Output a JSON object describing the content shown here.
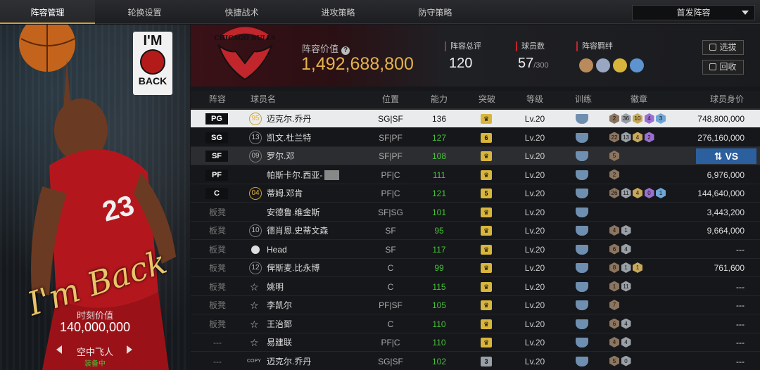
{
  "nav": {
    "tabs": [
      "阵容管理",
      "轮换设置",
      "快捷战术",
      "进攻策略",
      "防守策略"
    ],
    "active_tab": "阵容管理",
    "lineup_select": "首发阵容"
  },
  "left_panel": {
    "logo_text_top": "I'M",
    "logo_text_bottom": "BACK",
    "signature": "I'm Back",
    "value_label": "时刻价值",
    "value": "140,000,000",
    "skin_name": "空中飞人",
    "skin_status": "装备中"
  },
  "header": {
    "team_logo_text": "CHICAGO BULLS",
    "lineup_value_label": "阵容价值",
    "lineup_value": "1,492,688,800",
    "overall_label": "阵容总评",
    "overall": "120",
    "players_label": "球员数",
    "players": "57",
    "players_max": "/300",
    "bonds_label": "阵容羁绊",
    "filter_button": "选拔",
    "recycle_button": "回收"
  },
  "colors": {
    "accent": "#c9a23a",
    "value_gold": "#e5b24a",
    "power_green": "#46c23a",
    "vs_blue": "#2b5f9e",
    "selected_row": "#e9ebec"
  },
  "table": {
    "headers": [
      "阵容",
      "球员名",
      "位置",
      "能力",
      "突破",
      "等级",
      "训练",
      "徽章",
      "球员身价"
    ],
    "rows": [
      {
        "slot": "PG",
        "starter": true,
        "num": "95",
        "name": "迈克尔.乔丹",
        "pos": "SG|SF",
        "power": "136",
        "brk": "",
        "level": "Lv.20",
        "badges": [
          "2",
          "36",
          "10",
          "4",
          "3"
        ],
        "price": "748,800,000",
        "selected": true
      },
      {
        "slot": "SG",
        "starter": true,
        "num": "13",
        "name": "凯文.杜兰特",
        "pos": "SF|PF",
        "power": "127",
        "brk": "6",
        "level": "Lv.20",
        "badges": [
          "22",
          "13",
          "4",
          "2"
        ],
        "price": "276,160,000"
      },
      {
        "slot": "SF",
        "starter": true,
        "num": "09",
        "name": "罗尔.邓",
        "pos": "SF|PF",
        "power": "108",
        "brk": "",
        "level": "Lv.20",
        "badges": [
          "5"
        ],
        "price": "",
        "vs": "VS",
        "dark": true
      },
      {
        "slot": "PF",
        "starter": true,
        "num": "",
        "name": "帕斯卡尔.西亚-",
        "pos": "PF|C",
        "power": "111",
        "brk": "",
        "level": "Lv.20",
        "badges": [
          "2"
        ],
        "price": "6,976,000"
      },
      {
        "slot": "C",
        "starter": true,
        "num": "04",
        "name": "蒂姆.邓肯",
        "pos": "PF|C",
        "power": "121",
        "brk": "5",
        "level": "Lv.20",
        "badges": [
          "26",
          "11",
          "4",
          "0",
          "1"
        ],
        "price": "144,640,000"
      },
      {
        "slot": "板凳",
        "starter": false,
        "num": "",
        "name": "安德鲁.维金斯",
        "pos": "SF|SG",
        "power": "101",
        "brk": "",
        "level": "Lv.20",
        "badges": [],
        "price": "3,443,200"
      },
      {
        "slot": "板凳",
        "starter": false,
        "num": "10",
        "name": "德肖恩.史蒂文森",
        "pos": "SF",
        "power": "95",
        "brk": "",
        "level": "Lv.20",
        "badges": [
          "4",
          "1"
        ],
        "price": "9,664,000"
      },
      {
        "slot": "板凳",
        "starter": false,
        "num": "",
        "name": "Head",
        "pos": "SF",
        "power": "117",
        "brk": "",
        "level": "Lv.20",
        "badges": [
          "6",
          "4"
        ],
        "price": "---",
        "icon": "head"
      },
      {
        "slot": "板凳",
        "starter": false,
        "num": "12",
        "name": "俾斯麦.比永博",
        "pos": "C",
        "power": "99",
        "brk": "",
        "level": "Lv.20",
        "badges": [
          "8",
          "1",
          "1"
        ],
        "price": "761,600"
      },
      {
        "slot": "板凳",
        "starter": false,
        "num": "",
        "name": "姚明",
        "pos": "C",
        "power": "115",
        "brk": "",
        "level": "Lv.20",
        "badges": [
          "1",
          "11"
        ],
        "price": "---",
        "icon": "star"
      },
      {
        "slot": "板凳",
        "starter": false,
        "num": "",
        "name": "李凯尔",
        "pos": "PF|SF",
        "power": "105",
        "brk": "",
        "level": "Lv.20",
        "badges": [
          "7"
        ],
        "price": "---",
        "icon": "star"
      },
      {
        "slot": "板凳",
        "starter": false,
        "num": "",
        "name": "王治郅",
        "pos": "C",
        "power": "110",
        "brk": "",
        "level": "Lv.20",
        "badges": [
          "6",
          "4"
        ],
        "price": "---",
        "icon": "star"
      },
      {
        "slot": "---",
        "starter": false,
        "num": "",
        "name": "易建联",
        "pos": "PF|C",
        "power": "110",
        "brk": "",
        "level": "Lv.20",
        "badges": [
          "4",
          "4"
        ],
        "price": "---",
        "icon": "star"
      },
      {
        "slot": "---",
        "starter": false,
        "num": "",
        "name": "迈克尔.乔丹",
        "pos": "SG|SF",
        "power": "102",
        "brk": "3",
        "level": "Lv.20",
        "badges": [
          "5",
          "0"
        ],
        "price": "---",
        "icon": "copy",
        "copy": "COPY"
      }
    ]
  }
}
